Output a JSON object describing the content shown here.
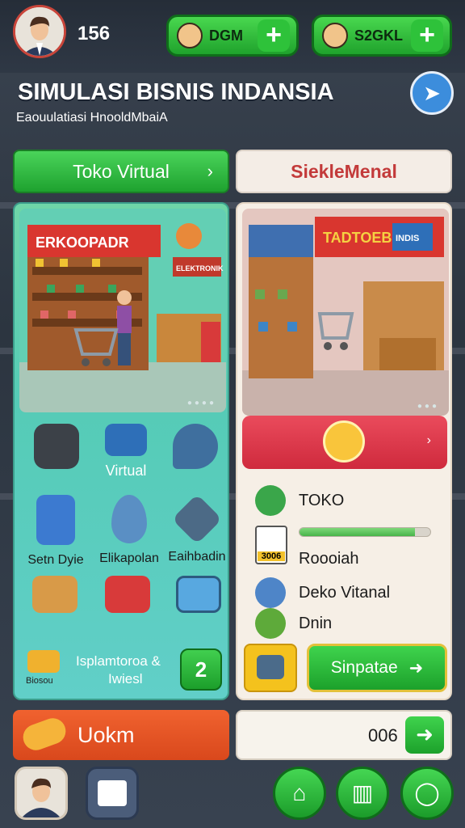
{
  "header": {
    "score": "156",
    "currency_1_label": "DGM",
    "currency_2_label": "S2GKL",
    "title": "SIMULASI BISNIS INDANSIA",
    "subtitle": "Eaouulatiasi HnooldMbaiA"
  },
  "tabs": {
    "left_label": "Toko Virtual",
    "right_label": "SiekleMenal"
  },
  "left_panel": {
    "store_sign": "ERKOOPADR",
    "sign_2": "ELEKTRONIK",
    "grid": [
      {
        "label": "",
        "icon": "camera-icon"
      },
      {
        "label": "Virtual",
        "icon": "browser-window-icon"
      },
      {
        "label": "",
        "icon": "speech-bubble-icon"
      },
      {
        "label": "Setn Dyie",
        "icon": "calculator-icon"
      },
      {
        "label": "Elikapolan",
        "icon": "location-pin-icon"
      },
      {
        "label": "Eaihbadin",
        "icon": "shield-icon"
      },
      {
        "label": "",
        "icon": "cart-box-icon"
      },
      {
        "label": "",
        "icon": "cart-red-icon"
      },
      {
        "label": "",
        "icon": "cart-blue-icon"
      }
    ],
    "footer_text_1": "Isplamtoroa &",
    "footer_text_2": "Iwiesl",
    "footer_small": "Biosou",
    "badge_value": "2"
  },
  "right_panel": {
    "store_sign": "TADTOEB",
    "sign_2": "INDIS",
    "stats": [
      {
        "label": "TOKO",
        "icon": "stopwatch-icon"
      },
      {
        "label": "Roooiah",
        "icon": "calendar-icon"
      },
      {
        "label": "Deko Vitanal",
        "icon": "gear-blue-icon"
      },
      {
        "label": "Dnin",
        "icon": "vegetables-icon"
      }
    ],
    "calendar_text": "3006",
    "progress": 0.88,
    "start_label": "Sinpatae"
  },
  "bottom": {
    "left_label": "Uokm",
    "right_value": "006"
  },
  "colors": {
    "green": "#2ec23a",
    "red": "#cf2a3d",
    "orange": "#e4531f",
    "teal": "#5ccdbc"
  }
}
